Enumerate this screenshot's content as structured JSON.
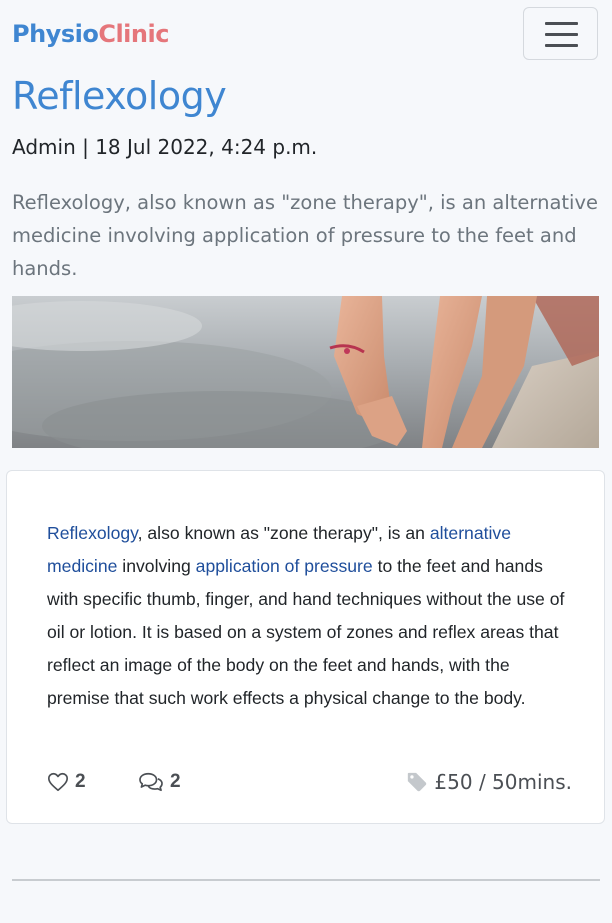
{
  "navbar": {
    "brand_part1": "Physio",
    "brand_part2": "Clinic",
    "brand_color_1": "#3f86d1",
    "brand_color_2": "#e5767b",
    "menu_icon": "hamburger-menu-icon"
  },
  "post": {
    "title": "Reflexology",
    "meta": "Admin | 18 Jul 2022, 4:24 p.m.",
    "excerpt": "Reflexology, also known as \"zone therapy\", is an alternative medicine involving application of pressure to the feet and hands.",
    "body": {
      "link1": "Reflexology",
      "text1": ", also known as \"zone therapy\", is an ",
      "link2": "alternative medicine",
      "text2": " involving ",
      "link3": "application of pressure",
      "text3": " to the feet and hands with specific thumb, finger, and hand techniques without the use of oil or lotion. It is based on a system of zones and reflex areas that reflect an image of the body on the feet and hands, with the premise that such work effects a physical change to the body."
    },
    "likes": "2",
    "comments": "2",
    "price": "£50 / 50mins.",
    "icons": {
      "like": "heart-icon",
      "comment": "comments-icon",
      "price": "tag-icon"
    }
  }
}
